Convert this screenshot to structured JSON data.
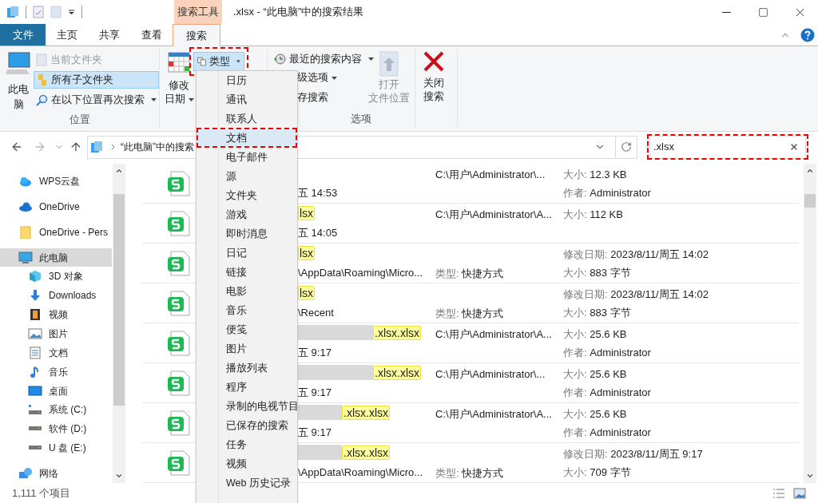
{
  "title_bar": {
    "contextual_tab": "搜索工具",
    "title": ".xlsx - “此电脑”中的搜索结果"
  },
  "tabs": [
    {
      "label": "文件",
      "kind": "file",
      "selected": false
    },
    {
      "label": "主页",
      "kind": "tab",
      "selected": false
    },
    {
      "label": "共享",
      "kind": "tab",
      "selected": false
    },
    {
      "label": "查看",
      "kind": "tab",
      "selected": false
    },
    {
      "label": "搜索",
      "kind": "tab",
      "selected": true
    }
  ],
  "ribbon": {
    "location": {
      "this_pc": [
        "此电",
        "脑"
      ],
      "current_folder": {
        "label": "当前文件夹",
        "disabled": true
      },
      "all_subfolders": {
        "label": "所有子文件夹",
        "selected": true
      },
      "search_again": "在以下位置再次搜索",
      "group_label": "位置"
    },
    "refine": {
      "modified_date": [
        "修改",
        "日期"
      ],
      "type": {
        "label": "类型",
        "selected": true,
        "annotated": true
      }
    },
    "options": {
      "recent": "最近的搜索内容",
      "advanced": "级选项",
      "save": "存搜索",
      "open_location": {
        "lines": [
          "打开",
          "文件位置"
        ],
        "disabled": true
      },
      "group_label": "选项"
    },
    "close": [
      "关闭",
      "搜索"
    ]
  },
  "type_menu": [
    {
      "label": "日历",
      "selected": false,
      "annotated": false
    },
    {
      "label": "通讯",
      "selected": false,
      "annotated": false
    },
    {
      "label": "联系人",
      "selected": false,
      "annotated": false
    },
    {
      "label": "文档",
      "selected": true,
      "annotated": true
    },
    {
      "label": "电子邮件",
      "selected": false,
      "annotated": false
    },
    {
      "label": "源",
      "selected": false,
      "annotated": false
    },
    {
      "label": "文件夹",
      "selected": false,
      "annotated": false
    },
    {
      "label": "游戏",
      "selected": false,
      "annotated": false
    },
    {
      "label": "即时消息",
      "selected": false,
      "annotated": false
    },
    {
      "label": "日记",
      "selected": false,
      "annotated": false
    },
    {
      "label": "链接",
      "selected": false,
      "annotated": false
    },
    {
      "label": "电影",
      "selected": false,
      "annotated": false
    },
    {
      "label": "音乐",
      "selected": false,
      "annotated": false
    },
    {
      "label": "便笺",
      "selected": false,
      "annotated": false
    },
    {
      "label": "图片",
      "selected": false,
      "annotated": false
    },
    {
      "label": "播放列表",
      "selected": false,
      "annotated": false
    },
    {
      "label": "程序",
      "selected": false,
      "annotated": false
    },
    {
      "label": "录制的电视节目",
      "selected": false,
      "annotated": false
    },
    {
      "label": "已保存的搜索",
      "selected": false,
      "annotated": false
    },
    {
      "label": "任务",
      "selected": false,
      "annotated": false
    },
    {
      "label": "视频",
      "selected": false,
      "annotated": false
    },
    {
      "label": "Web 历史记录",
      "selected": false,
      "annotated": false
    }
  ],
  "address": {
    "path": "“此电脑”中的搜索"
  },
  "search": {
    "value": ".xlsx",
    "annotated": true
  },
  "nav": [
    {
      "label": "WPS云盘",
      "kind": "wps-cloud",
      "selected": false
    },
    {
      "label": "OneDrive",
      "kind": "onedrive",
      "selected": false
    },
    {
      "label": "OneDrive - Pers",
      "kind": "folder",
      "selected": false
    },
    {
      "label": "此电脑",
      "kind": "computer",
      "selected": true,
      "children": [
        {
          "label": "3D 对象",
          "kind": "cube",
          "selected": false
        },
        {
          "label": "Downloads",
          "kind": "download",
          "selected": false
        },
        {
          "label": "视频",
          "kind": "video",
          "selected": false
        },
        {
          "label": "图片",
          "kind": "picture",
          "selected": false
        },
        {
          "label": "文档",
          "kind": "document",
          "selected": false
        },
        {
          "label": "音乐",
          "kind": "music",
          "selected": false
        },
        {
          "label": "桌面",
          "kind": "desktop",
          "selected": false
        },
        {
          "label": "系统 (C:)",
          "kind": "system-drive",
          "selected": false
        },
        {
          "label": "软件 (D:)",
          "kind": "drive",
          "selected": false
        },
        {
          "label": "U 盘 (E:)",
          "kind": "drive",
          "selected": false
        }
      ]
    },
    {
      "label": "网络",
      "kind": "network",
      "selected": false
    }
  ],
  "results": [
    {
      "kind": "plain",
      "detail": "五 14:53",
      "path": "C:\\用户\\Administrator\\...",
      "props": [
        {
          "label": "大小:",
          "value": "12.3 KB"
        },
        {
          "label": "作者:",
          "value": "Administrator"
        }
      ]
    },
    {
      "name": "lsx",
      "kind": "plain",
      "detail": "五 14:05",
      "path": "C:\\用户\\Administrator\\A...",
      "props": [
        {
          "label": "大小:",
          "value": "112 KB"
        }
      ]
    },
    {
      "name": "lsx",
      "kind": "plain",
      "detail": "\\AppData\\Roaming\\Micro...",
      "type": {
        "label": "类型:",
        "value": "快捷方式"
      },
      "props": [
        {
          "label": "修改日期:",
          "value": "2023/8/11/周五 14:02"
        },
        {
          "label": "大小:",
          "value": "883 字节"
        }
      ]
    },
    {
      "name": "lsx",
      "kind": "plain",
      "detail": "\\Recent",
      "type": {
        "label": "类型:",
        "value": "快捷方式"
      },
      "props": [
        {
          "label": "修改日期:",
          "value": "2023/8/11/周五 14:02"
        },
        {
          "label": "大小:",
          "value": "883 字节"
        }
      ]
    },
    {
      "name": ".xlsx.xlsx",
      "kind": "redacted-long",
      "detail": "五 9:17",
      "path": "C:\\用户\\Administrator\\A...",
      "props": [
        {
          "label": "大小:",
          "value": "25.6 KB"
        },
        {
          "label": "作者:",
          "value": "Administrator"
        }
      ]
    },
    {
      "name": ".xlsx.xlsx",
      "kind": "redacted-long",
      "detail": "五 9:17",
      "path": "C:\\用户\\Administrator\\...",
      "props": [
        {
          "label": "大小:",
          "value": "25.6 KB"
        },
        {
          "label": "作者:",
          "value": "Administrator"
        }
      ]
    },
    {
      "name": ".xlsx.xlsx",
      "kind": "redacted-short",
      "detail": "五 9:17",
      "path": "C:\\用户\\Administrator\\A...",
      "props": [
        {
          "label": "大小:",
          "value": "25.6 KB"
        },
        {
          "label": "作者:",
          "value": "Administrator"
        }
      ]
    },
    {
      "name": ".xlsx.xlsx",
      "kind": "redacted-short",
      "detail": "\\AppData\\Roaming\\Micro...",
      "type": {
        "label": "类型:",
        "value": "快捷方式"
      },
      "props": [
        {
          "label": "修改日期:",
          "value": "2023/8/11/周五 9:17"
        },
        {
          "label": "大小:",
          "value": "709 字节"
        }
      ]
    }
  ],
  "status_bar": {
    "count": "1,111 个项目"
  }
}
